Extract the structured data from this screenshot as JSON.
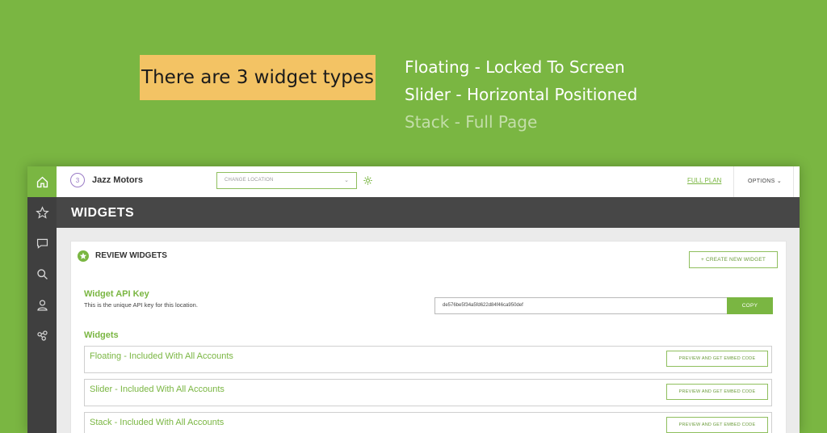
{
  "annotation": {
    "callout": "There are 3 widget types",
    "types": [
      "Floating - Locked To Screen",
      "Slider - Horizontal Positioned",
      "Stack - Full Page"
    ]
  },
  "sidebar": {
    "items": [
      {
        "icon": "home-icon",
        "active": true
      },
      {
        "icon": "star-icon",
        "active": false
      },
      {
        "icon": "chat-icon",
        "active": false
      },
      {
        "icon": "search-icon",
        "active": false
      },
      {
        "icon": "user-icon",
        "active": false
      },
      {
        "icon": "network-icon",
        "active": false
      }
    ]
  },
  "topbar": {
    "logo_text": "3",
    "company": "Jazz Motors",
    "location_placeholder": "CHANGE LOCATION",
    "full_plan": "FULL PLAN",
    "options": "OPTIONS"
  },
  "page": {
    "title": "WIDGETS"
  },
  "card": {
    "title": "REVIEW WIDGETS",
    "create_button": "+ CREATE NEW WIDGET",
    "api_key_title": "Widget API Key",
    "api_key_desc": "This is the unique API key for this location.",
    "api_key_value": "de576be5f34a5fd622d84f46ca950def",
    "copy_button": "COPY",
    "widgets_title": "Widgets",
    "widgets": [
      {
        "name": "Floating - Included With All Accounts",
        "button": "PREVIEW AND GET EMBED CODE"
      },
      {
        "name": "Slider - Included With All Accounts",
        "button": "PREVIEW AND GET EMBED CODE"
      },
      {
        "name": "Stack - Included With All Accounts",
        "button": "PREVIEW AND GET EMBED CODE"
      }
    ]
  },
  "colors": {
    "accent": "#7ab642",
    "callout_bg": "#f3c364",
    "sidebar_bg": "#3f3f3f",
    "titlebar_bg": "#474747"
  }
}
